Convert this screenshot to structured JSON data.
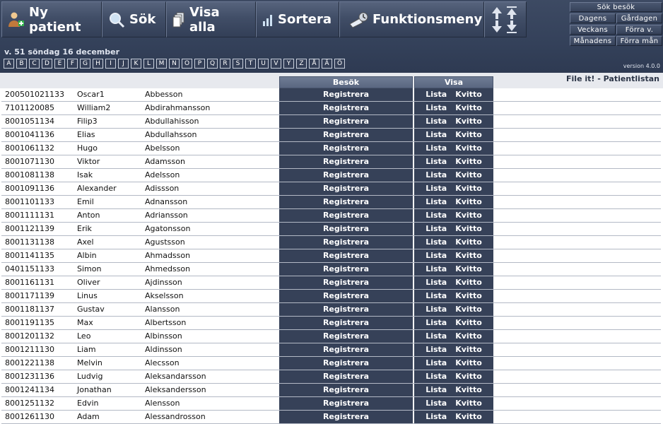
{
  "toolbar": {
    "ny_patient": "Ny patient",
    "sok": "Sök",
    "visa_alla": "Visa alla",
    "sortera": "Sortera",
    "funktionsmeny": "Funktionsmeny"
  },
  "sub_menu": {
    "sok_besok": "Sök besök",
    "dagens": "Dagens",
    "gardagen": "Gårdagen",
    "veckans": "Veckans",
    "forra_v": "Förra v.",
    "manadens": "Månadens",
    "forra_man": "Förra mån"
  },
  "version": "version 4.0.0",
  "date_line": "v. 51 söndag 16 december",
  "alphabet": [
    "A",
    "B",
    "C",
    "D",
    "E",
    "F",
    "G",
    "H",
    "I",
    "J",
    "K",
    "L",
    "M",
    "N",
    "O",
    "P",
    "Q",
    "R",
    "S",
    "T",
    "U",
    "V",
    "Y",
    "Z",
    "Å",
    "Ä",
    "Ö"
  ],
  "columns": {
    "besok": "Besök",
    "visa": "Visa"
  },
  "app_title": "File it! - Patientlistan",
  "actions": {
    "registrera": "Registrera",
    "lista": "Lista",
    "kvitto": "Kvitto"
  },
  "patients": [
    {
      "pnr": "200501021133",
      "first": "Oscar1",
      "last": "Abbesson"
    },
    {
      "pnr": "7101120085",
      "first": "William2",
      "last": "Abdirahmansson"
    },
    {
      "pnr": "8001051134",
      "first": "Filip3",
      "last": "Abdullahisson"
    },
    {
      "pnr": "8001041136",
      "first": "Elias",
      "last": "Abdullahsson"
    },
    {
      "pnr": "8001061132",
      "first": "Hugo",
      "last": "Abelsson"
    },
    {
      "pnr": "8001071130",
      "first": "Viktor",
      "last": "Adamsson"
    },
    {
      "pnr": "8001081138",
      "first": "Isak",
      "last": "Adelsson"
    },
    {
      "pnr": "8001091136",
      "first": "Alexander",
      "last": "Adissson"
    },
    {
      "pnr": "8001101133",
      "first": "Emil",
      "last": "Adnansson"
    },
    {
      "pnr": "8001111131",
      "first": "Anton",
      "last": "Adriansson"
    },
    {
      "pnr": "8001121139",
      "first": "Erik",
      "last": "Agatonsson"
    },
    {
      "pnr": "8001131138",
      "first": "Axel",
      "last": "Agustsson"
    },
    {
      "pnr": "8001141135",
      "first": "Albin",
      "last": "Ahmadsson"
    },
    {
      "pnr": "0401151133",
      "first": "Simon",
      "last": "Ahmedsson"
    },
    {
      "pnr": "8001161131",
      "first": "Oliver",
      "last": "Ajdinsson"
    },
    {
      "pnr": "8001171139",
      "first": "Linus",
      "last": "Akselsson"
    },
    {
      "pnr": "8001181137",
      "first": "Gustav",
      "last": "Alansson"
    },
    {
      "pnr": "8001191135",
      "first": "Max",
      "last": "Albertsson"
    },
    {
      "pnr": "8001201132",
      "first": "Leo",
      "last": "Albinsson"
    },
    {
      "pnr": "8001211130",
      "first": "Liam",
      "last": "Aldinsson"
    },
    {
      "pnr": "8001221138",
      "first": "Melvin",
      "last": "Alecsson"
    },
    {
      "pnr": "8001231136",
      "first": "Ludvig",
      "last": "Aleksandarsson"
    },
    {
      "pnr": "8001241134",
      "first": "Jonathan",
      "last": "Aleksandersson"
    },
    {
      "pnr": "8001251132",
      "first": "Edvin",
      "last": "Alensson"
    },
    {
      "pnr": "8001261130",
      "first": "Adam",
      "last": "Alessandrosson"
    }
  ]
}
